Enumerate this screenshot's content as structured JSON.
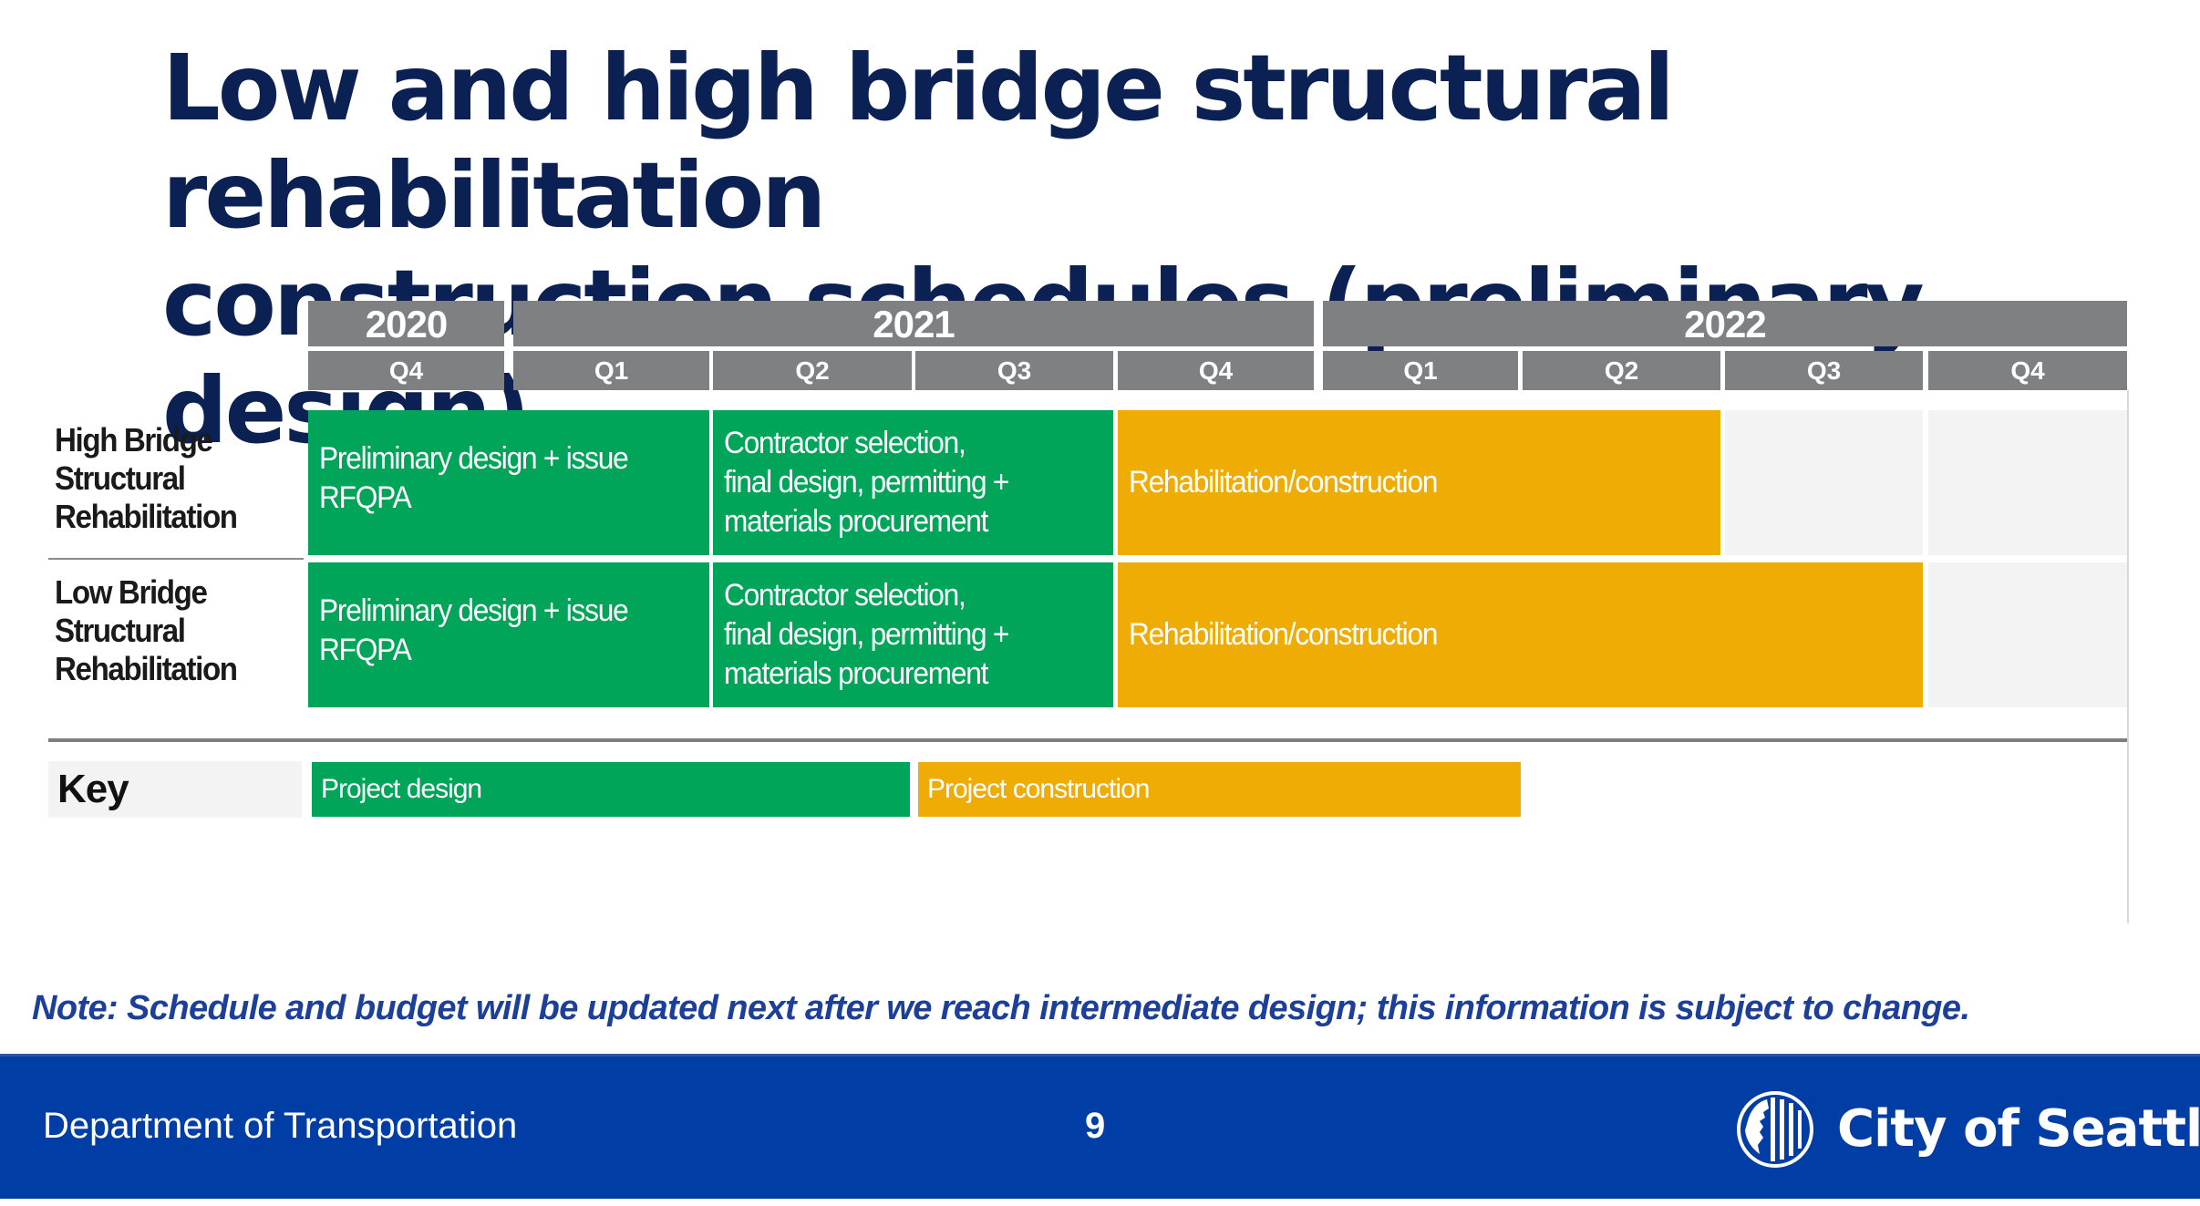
{
  "slide": {
    "title_lines": [
      "Low and high bridge structural rehabilitation",
      "construction schedules (preliminary design)"
    ],
    "note": "Note:  Schedule and budget will be updated next after we reach intermediate design; this information is subject to change.",
    "footer": {
      "department": "Department of Transportation",
      "page_number": "9",
      "logo_text": "City of Seattle",
      "logo_icon": "city-of-seattle-seal-icon"
    }
  },
  "colors": {
    "title": "#0c2153",
    "header_gray": "#7f8082",
    "design_green": "#00a55a",
    "construction_amber": "#eeac05",
    "empty_cell": "#f3f3f3",
    "footer_blue": "#003da5",
    "note_blue": "#1c3f99"
  },
  "chart_data": {
    "type": "gantt",
    "title": "Low and high bridge structural rehabilitation construction schedules (preliminary design)",
    "years": [
      {
        "label": "2020",
        "quarters": 1
      },
      {
        "label": "2021",
        "quarters": 4
      },
      {
        "label": "2022",
        "quarters": 4
      }
    ],
    "quarters": [
      "Q4",
      "Q1",
      "Q2",
      "Q3",
      "Q4",
      "Q1",
      "Q2",
      "Q3",
      "Q4"
    ],
    "quarter_periods": [
      "2020 Q4",
      "2021 Q1",
      "2021 Q2",
      "2021 Q3",
      "2021 Q4",
      "2022 Q1",
      "2022 Q2",
      "2022 Q3",
      "2022 Q4"
    ],
    "rows": [
      {
        "label_lines": [
          "High Bridge",
          "Structural",
          "Rehabilitation"
        ],
        "tasks": [
          {
            "label_lines": [
              "Preliminary design + issue",
              "RFQPA"
            ],
            "category": "design",
            "start": "2020 Q4",
            "end": "2021 Q1",
            "start_index": 0,
            "span": 2
          },
          {
            "label_lines": [
              "Contractor selection,",
              "final design, permitting +",
              "materials procurement"
            ],
            "category": "design",
            "start": "2021 Q2",
            "end": "2021 Q3",
            "start_index": 2,
            "span": 2
          },
          {
            "label_lines": [
              "Rehabilitation/construction"
            ],
            "category": "construction",
            "start": "2021 Q4",
            "end": "2022 Q2",
            "start_index": 4,
            "span": 3
          }
        ]
      },
      {
        "label_lines": [
          "Low Bridge",
          "Structural",
          "Rehabilitation"
        ],
        "tasks": [
          {
            "label_lines": [
              "Preliminary design + issue",
              "RFQPA"
            ],
            "category": "design",
            "start": "2020 Q4",
            "end": "2021 Q1",
            "start_index": 0,
            "span": 2
          },
          {
            "label_lines": [
              "Contractor selection,",
              "final design, permitting +",
              "materials procurement"
            ],
            "category": "design",
            "start": "2021 Q2",
            "end": "2021 Q3",
            "start_index": 2,
            "span": 2
          },
          {
            "label_lines": [
              "Rehabilitation/construction"
            ],
            "category": "construction",
            "start": "2021 Q4",
            "end": "2022 Q3",
            "start_index": 4,
            "span": 4
          }
        ]
      }
    ],
    "legend": {
      "title": "Key",
      "placement": "bottom-left",
      "items": [
        {
          "label": "Project design",
          "category": "design",
          "color": "#00a55a"
        },
        {
          "label": "Project construction",
          "category": "construction",
          "color": "#eeac05"
        }
      ]
    }
  }
}
